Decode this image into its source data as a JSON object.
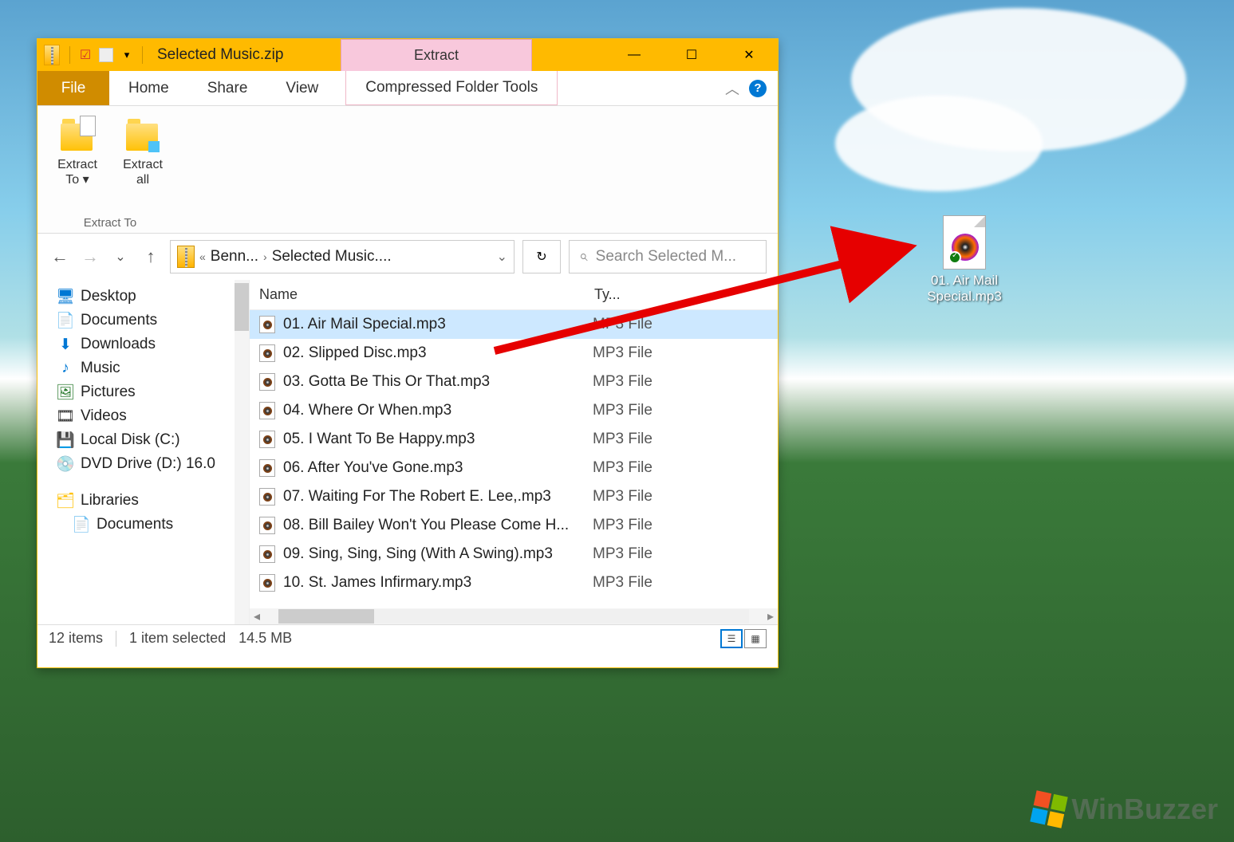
{
  "titlebar": {
    "title": "Selected Music.zip",
    "contextual_label": "Extract"
  },
  "window_controls": {
    "min": "—",
    "max": "☐",
    "close": "✕"
  },
  "tabs": {
    "file": "File",
    "home": "Home",
    "share": "Share",
    "view": "View",
    "contextual": "Compressed Folder Tools"
  },
  "ribbon": {
    "extract_to": "Extract\nTo ▾",
    "extract_all": "Extract\nall",
    "group_label": "Extract To",
    "collapse": "︿",
    "help": "?"
  },
  "nav": {
    "back": "←",
    "forward": "→",
    "recent": "⌄",
    "up": "↑"
  },
  "address": {
    "sep0": "«",
    "crumb1": "Benn...",
    "sep1": "›",
    "crumb2": "Selected Music....",
    "dropdown": "⌄",
    "refresh": "↻"
  },
  "search": {
    "icon": "⌕",
    "placeholder": "Search Selected M..."
  },
  "navpane": {
    "items": [
      {
        "icon": "🖥",
        "label": "Desktop",
        "color": "#0078d4"
      },
      {
        "icon": "📄",
        "label": "Documents",
        "color": "#666"
      },
      {
        "icon": "⬇",
        "label": "Downloads",
        "color": "#0078d4"
      },
      {
        "icon": "♪",
        "label": "Music",
        "color": "#0078d4"
      },
      {
        "icon": "🖼",
        "label": "Pictures",
        "color": "#2e7d32"
      },
      {
        "icon": "🎞",
        "label": "Videos",
        "color": "#333"
      },
      {
        "icon": "💾",
        "label": "Local Disk (C:)",
        "color": "#555"
      },
      {
        "icon": "💿",
        "label": "DVD Drive (D:) 16.0",
        "color": "#d32f2f"
      }
    ],
    "libraries_label": "Libraries",
    "lib_documents": "Documents"
  },
  "columns": {
    "name": "Name",
    "type": "Ty..."
  },
  "files": [
    {
      "name": "01. Air Mail Special.mp3",
      "type": "MP3 File",
      "selected": true
    },
    {
      "name": "02. Slipped Disc.mp3",
      "type": "MP3 File",
      "selected": false
    },
    {
      "name": "03. Gotta Be This Or That.mp3",
      "type": "MP3 File",
      "selected": false
    },
    {
      "name": "04. Where Or When.mp3",
      "type": "MP3 File",
      "selected": false
    },
    {
      "name": "05. I Want To Be Happy.mp3",
      "type": "MP3 File",
      "selected": false
    },
    {
      "name": "06. After You've Gone.mp3",
      "type": "MP3 File",
      "selected": false
    },
    {
      "name": "07. Waiting For The Robert E. Lee,.mp3",
      "type": "MP3 File",
      "selected": false
    },
    {
      "name": "08. Bill Bailey Won't You Please Come H...",
      "type": "MP3 File",
      "selected": false
    },
    {
      "name": "09. Sing, Sing, Sing (With A Swing).mp3",
      "type": "MP3 File",
      "selected": false
    },
    {
      "name": "10. St. James Infirmary.mp3",
      "type": "MP3 File",
      "selected": false
    }
  ],
  "status": {
    "count": "12 items",
    "selection": "1 item selected",
    "size": "14.5 MB"
  },
  "desktop_file": {
    "line1": "01. Air Mail",
    "line2": "Special.mp3"
  },
  "watermark": "WinBuzzer"
}
